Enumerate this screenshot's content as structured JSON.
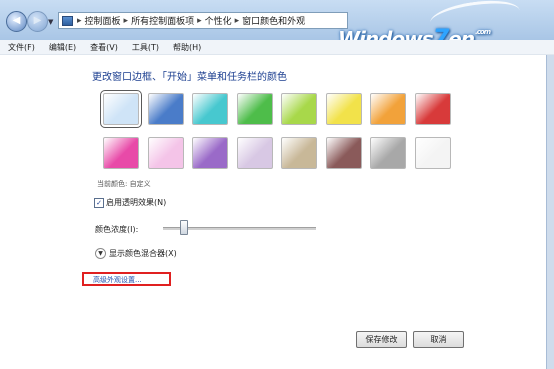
{
  "nav": {
    "back_icon": "back-arrow-icon",
    "forward_icon": "forward-arrow-icon",
    "breadcrumb": [
      "控制面板",
      "所有控制面板项",
      "个性化",
      "窗口颜色和外观"
    ],
    "separator": "▸"
  },
  "logo": {
    "text_a": "Windows",
    "text_b": "7",
    "text_c": "en",
    "text_d": ".com"
  },
  "menu": [
    "文件(F)",
    "编辑(E)",
    "查看(V)",
    "工具(T)",
    "帮助(H)"
  ],
  "main": {
    "heading": "更改窗口边框、「开始」菜单和任务栏的颜色",
    "swatches": [
      {
        "name": "sky",
        "color": "#cfe4f7",
        "selected": true
      },
      {
        "name": "twilight",
        "color": "#4a7cc9"
      },
      {
        "name": "sea",
        "color": "#47c8cf"
      },
      {
        "name": "leaf",
        "color": "#4ebd4a"
      },
      {
        "name": "lime",
        "color": "#a8d84a"
      },
      {
        "name": "lemon",
        "color": "#f2e24a"
      },
      {
        "name": "pumpkin",
        "color": "#f2a23a"
      },
      {
        "name": "ruby",
        "color": "#d83a3a"
      },
      {
        "name": "fuchsia",
        "color": "#e84aa8"
      },
      {
        "name": "blush",
        "color": "#f4c4e8"
      },
      {
        "name": "violet",
        "color": "#9a6ac8"
      },
      {
        "name": "lavender",
        "color": "#d8c8e4"
      },
      {
        "name": "taupe",
        "color": "#c8b898"
      },
      {
        "name": "chocolate",
        "color": "#8a5a5a"
      },
      {
        "name": "slate",
        "color": "#a8a8a8"
      },
      {
        "name": "frost",
        "color": "#f4f4f4"
      }
    ],
    "current_color_label": "当前颜色: 自定义",
    "transparency": {
      "label": "启用透明效果(N)",
      "checked": true
    },
    "intensity": {
      "label": "颜色浓度(I):",
      "value": 0.13
    },
    "mixer_label": "显示颜色混合器(X)",
    "advanced_link": "高级外观设置...",
    "highlight_color": "#e02020"
  },
  "buttons": {
    "save": "保存修改",
    "cancel": "取消"
  }
}
